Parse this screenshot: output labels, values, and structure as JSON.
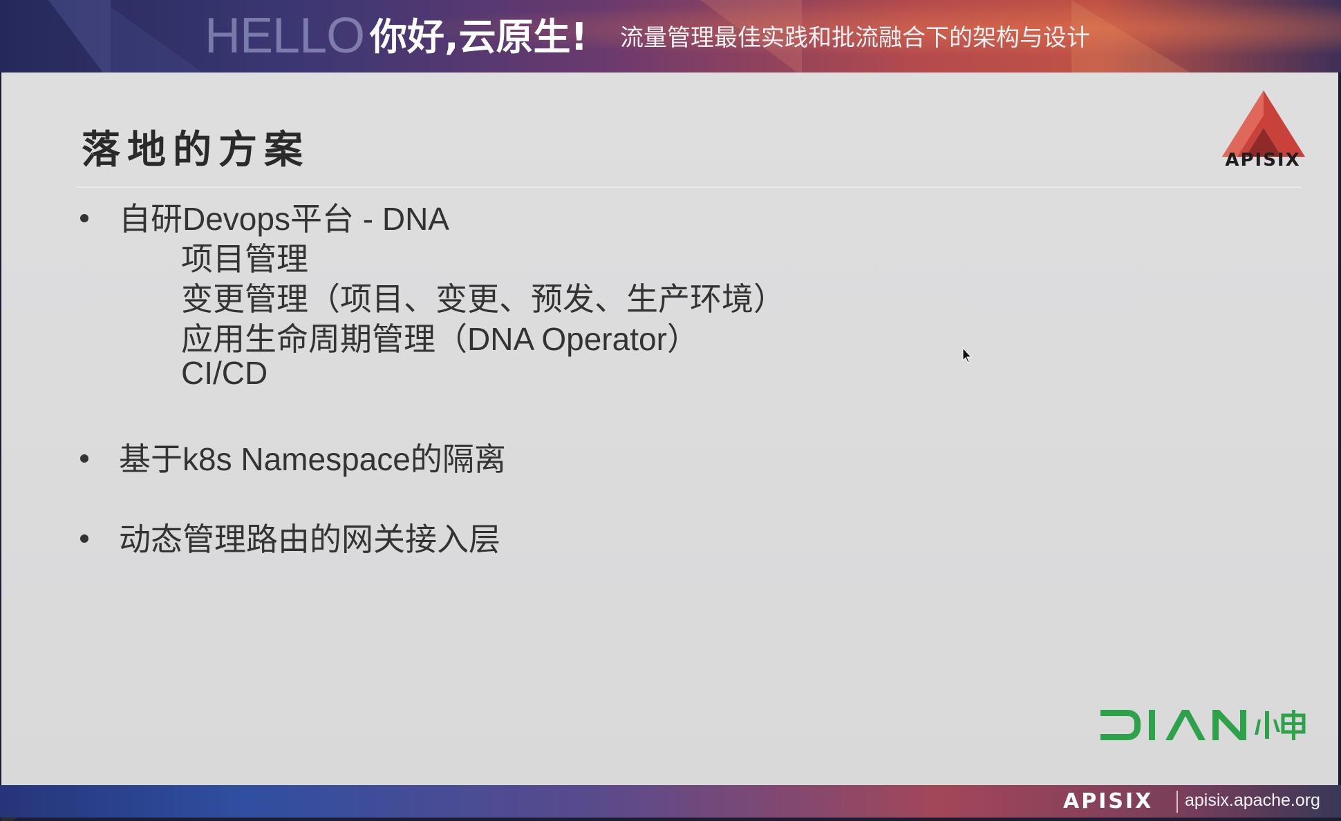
{
  "banner": {
    "hello": "HELLO",
    "title": "你好,云原生!",
    "subtitle": "流量管理最佳实践和批流融合下的架构与设计"
  },
  "slide": {
    "title": "落地的方案",
    "logo_text": "APISIX",
    "bullets": [
      {
        "text": "自研Devops平台 - DNA",
        "sub": [
          "项目管理",
          "变更管理（项目、变更、预发、生产环境）",
          "应用生命周期管理（DNA Operator）",
          "CI/CD"
        ]
      },
      {
        "text": "基于k8s Namespace的隔离"
      },
      {
        "text": "动态管理路由的网关接入层"
      }
    ],
    "brand_logo": "DIAN 小电"
  },
  "footer": {
    "brand": "APISIX",
    "url": "apisix.apache.org"
  },
  "colors": {
    "slide_bg": "#dddddd",
    "text": "#333333",
    "logo_red": "#c8413a",
    "dian_green": "#2ea24a"
  }
}
